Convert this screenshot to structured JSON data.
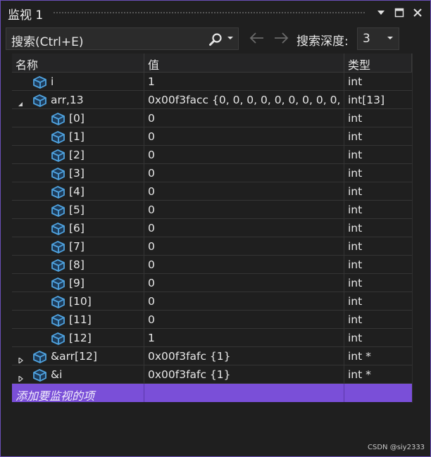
{
  "window": {
    "title": "监视 1"
  },
  "toolbar": {
    "search_placeholder": "搜索(Ctrl+E)",
    "depth_label": "搜索深度:",
    "depth_value": "3"
  },
  "columns": {
    "name": "名称",
    "value": "值",
    "type": "类型"
  },
  "rows": [
    {
      "name": "i",
      "value": "1",
      "type": "int",
      "level": 0,
      "expander": "none"
    },
    {
      "name": "arr,13",
      "value": "0x00f3facc {0, 0, 0, 0, 0, 0, 0, 0, 0, ...",
      "type": "int[13]",
      "level": 0,
      "expander": "expanded"
    },
    {
      "name": "[0]",
      "value": "0",
      "type": "int",
      "level": 1,
      "expander": "none"
    },
    {
      "name": "[1]",
      "value": "0",
      "type": "int",
      "level": 1,
      "expander": "none"
    },
    {
      "name": "[2]",
      "value": "0",
      "type": "int",
      "level": 1,
      "expander": "none"
    },
    {
      "name": "[3]",
      "value": "0",
      "type": "int",
      "level": 1,
      "expander": "none"
    },
    {
      "name": "[4]",
      "value": "0",
      "type": "int",
      "level": 1,
      "expander": "none"
    },
    {
      "name": "[5]",
      "value": "0",
      "type": "int",
      "level": 1,
      "expander": "none"
    },
    {
      "name": "[6]",
      "value": "0",
      "type": "int",
      "level": 1,
      "expander": "none"
    },
    {
      "name": "[7]",
      "value": "0",
      "type": "int",
      "level": 1,
      "expander": "none"
    },
    {
      "name": "[8]",
      "value": "0",
      "type": "int",
      "level": 1,
      "expander": "none"
    },
    {
      "name": "[9]",
      "value": "0",
      "type": "int",
      "level": 1,
      "expander": "none"
    },
    {
      "name": "[10]",
      "value": "0",
      "type": "int",
      "level": 1,
      "expander": "none"
    },
    {
      "name": "[11]",
      "value": "0",
      "type": "int",
      "level": 1,
      "expander": "none"
    },
    {
      "name": "[12]",
      "value": "1",
      "type": "int",
      "level": 1,
      "expander": "none"
    },
    {
      "name": "&arr[12]",
      "value": "0x00f3fafc {1}",
      "type": "int *",
      "level": 0,
      "expander": "collapsed"
    },
    {
      "name": "&i",
      "value": "0x00f3fafc {1}",
      "type": "int *",
      "level": 0,
      "expander": "collapsed"
    }
  ],
  "add_item": {
    "label": "添加要监视的项"
  },
  "watermark": "CSDN @siy2333",
  "icons": {
    "variable": "variable-cube-icon",
    "search": "search-icon",
    "back": "arrow-left-icon",
    "forward": "arrow-right-icon"
  },
  "colors": {
    "accent": "#7a4fd8",
    "icon_blue": "#4fa3e0",
    "background": "#1f1f1f"
  }
}
